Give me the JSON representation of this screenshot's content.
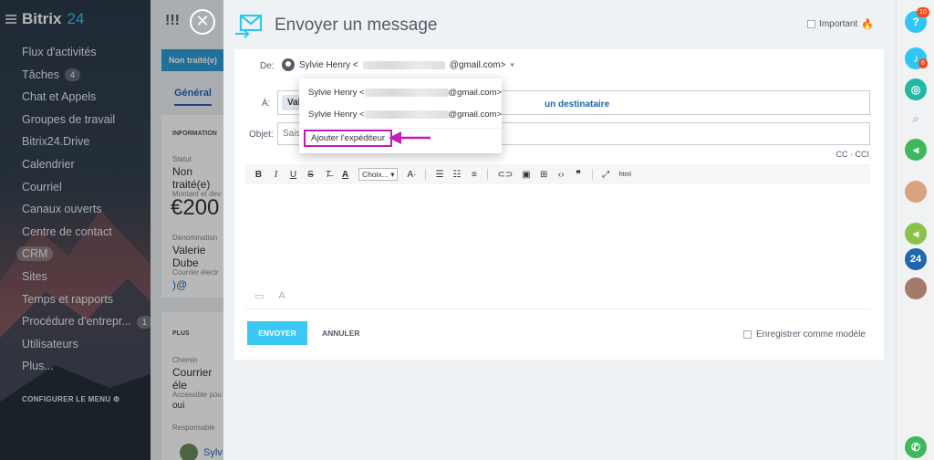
{
  "sidebar": {
    "logo_name": "Bitrix",
    "logo_num": "24",
    "items": [
      {
        "label": "Flux d'activités",
        "badge": ""
      },
      {
        "label": "Tâches",
        "badge": "4"
      },
      {
        "label": "Chat et Appels",
        "badge": ""
      },
      {
        "label": "Groupes de travail",
        "badge": ""
      },
      {
        "label": "Bitrix24.Drive",
        "badge": ""
      },
      {
        "label": "Calendrier",
        "badge": ""
      },
      {
        "label": "Courriel",
        "badge": ""
      },
      {
        "label": "Canaux ouverts",
        "badge": ""
      },
      {
        "label": "Centre de contact",
        "badge": ""
      },
      {
        "label": "CRM",
        "badge": ""
      },
      {
        "label": "Sites",
        "badge": ""
      },
      {
        "label": "Temps et rapports",
        "badge": ""
      },
      {
        "label": "Procédure d'entrepr...",
        "badge": "1"
      },
      {
        "label": "Utilisateurs",
        "badge": ""
      },
      {
        "label": "Plus...",
        "badge": ""
      }
    ],
    "configure_label": "CONFIGURER LE MENU"
  },
  "crm": {
    "top_text": "!!!",
    "stage": "Non traité(e)",
    "tab_general": "Général",
    "info_header": "INFORMATION",
    "status_label": "Statut",
    "status_value": "Non traité(e)",
    "amount_label": "Montant et dev",
    "amount_value": "€200",
    "name_label": "Dénomination",
    "name_value": "Valerie Dube",
    "email_label": "Courrier électr",
    "email_value": ")@",
    "plus_header": "PLUS",
    "path_label": "Chemin",
    "path_value": "Courrier éle",
    "access_label": "Accessible pou",
    "access_value": "oui",
    "resp_label": "Responsable",
    "resp_value": "Sylv"
  },
  "slider": {
    "title": "Envoyer un message",
    "important_label": "Important",
    "from_label": "De:",
    "from_name": "Sylvie Henry <",
    "from_domain": "@gmail.com>",
    "to_label": "À:",
    "to_chip": "Val",
    "add_recipient": "un destinataire",
    "subject_label": "Objet:",
    "subject_placeholder": "Sais",
    "cc_label": "CC · CCI",
    "font_select": "Choix...",
    "send_label": "ENVOYER",
    "cancel_label": "ANNULER",
    "save_template_label": "Enregistrer comme modèle"
  },
  "dropdown": {
    "items": [
      {
        "name": "Sylvie Henry <",
        "domain": "@gmail.com>"
      },
      {
        "name": "Sylvie Henry <",
        "domain": "@gmail.com>"
      }
    ],
    "add_sender": "Ajouter l'expéditeur"
  },
  "rightbar": {
    "help_badge": "10",
    "notif_badge": "6",
    "calendar_num": "24"
  },
  "colors": {
    "accent": "#3bc8f5",
    "link": "#2067b0",
    "highlight": "#c21cb5"
  }
}
